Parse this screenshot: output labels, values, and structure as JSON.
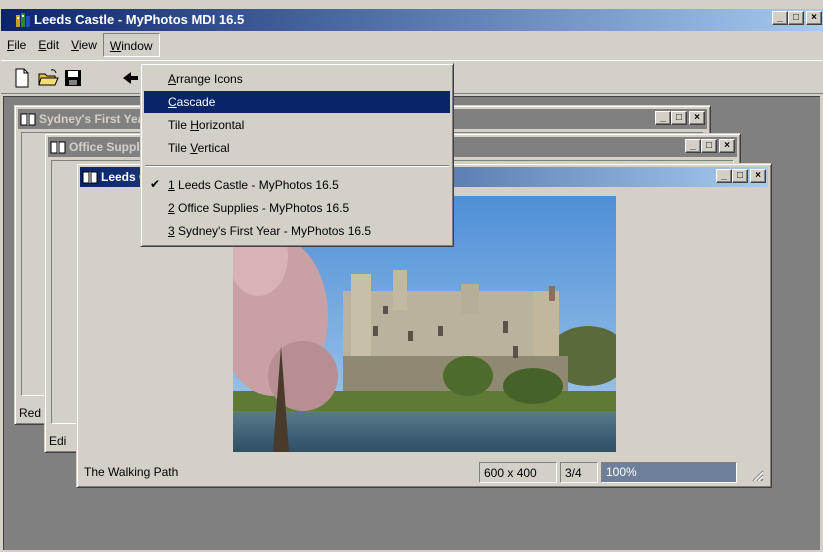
{
  "app": {
    "title": "Leeds Castle - MyPhotos MDI 16.5",
    "caption_buttons": {
      "minimize": "_",
      "maximize": "□",
      "close": "×"
    }
  },
  "menubar": {
    "file": {
      "hotkey": "F",
      "rest": "ile"
    },
    "edit": {
      "hotkey": "E",
      "rest": "dit"
    },
    "view": {
      "hotkey": "V",
      "rest": "iew"
    },
    "window": {
      "hotkey": "W",
      "rest": "indow"
    }
  },
  "toolbar": {
    "icons": [
      "new-file-icon",
      "open-folder-icon",
      "save-disk-icon",
      "back-arrow-icon"
    ]
  },
  "window_menu": {
    "items": [
      {
        "hotkey": "A",
        "rest": "rrange Icons",
        "pre": ""
      },
      {
        "hotkey": "C",
        "rest": "ascade",
        "pre": ""
      },
      {
        "hotkey": "H",
        "rest": "orizontal",
        "pre": "Tile "
      },
      {
        "hotkey": "V",
        "rest": "ertical",
        "pre": "Tile "
      }
    ],
    "windows": [
      {
        "hotkey": "1",
        "rest": " Leeds Castle - MyPhotos 16.5",
        "checked": "✔"
      },
      {
        "hotkey": "2",
        "rest": " Office Supplies - MyPhotos 16.5",
        "checked": ""
      },
      {
        "hotkey": "3",
        "rest": " Sydney's First Year - MyPhotos 16.5",
        "checked": ""
      }
    ]
  },
  "children": {
    "sydney": {
      "title": "Sydney's First Year - MyPhotos 16.5",
      "status": "Red"
    },
    "office": {
      "title": "Office Supplies - MyPhotos 16.5",
      "status": "Edi"
    },
    "leeds": {
      "title": "Leeds Castle - MyPhotos 16.5",
      "caption": "The Walking Path",
      "dimensions": "600 x 400",
      "position": "3/4",
      "zoom": "100%",
      "progress_fraction": 1.0
    }
  },
  "colors": {
    "active_title": "#0a246a",
    "inactive_title": "#808080",
    "face": "#d4d0c8",
    "progress": "#6e7f99"
  }
}
